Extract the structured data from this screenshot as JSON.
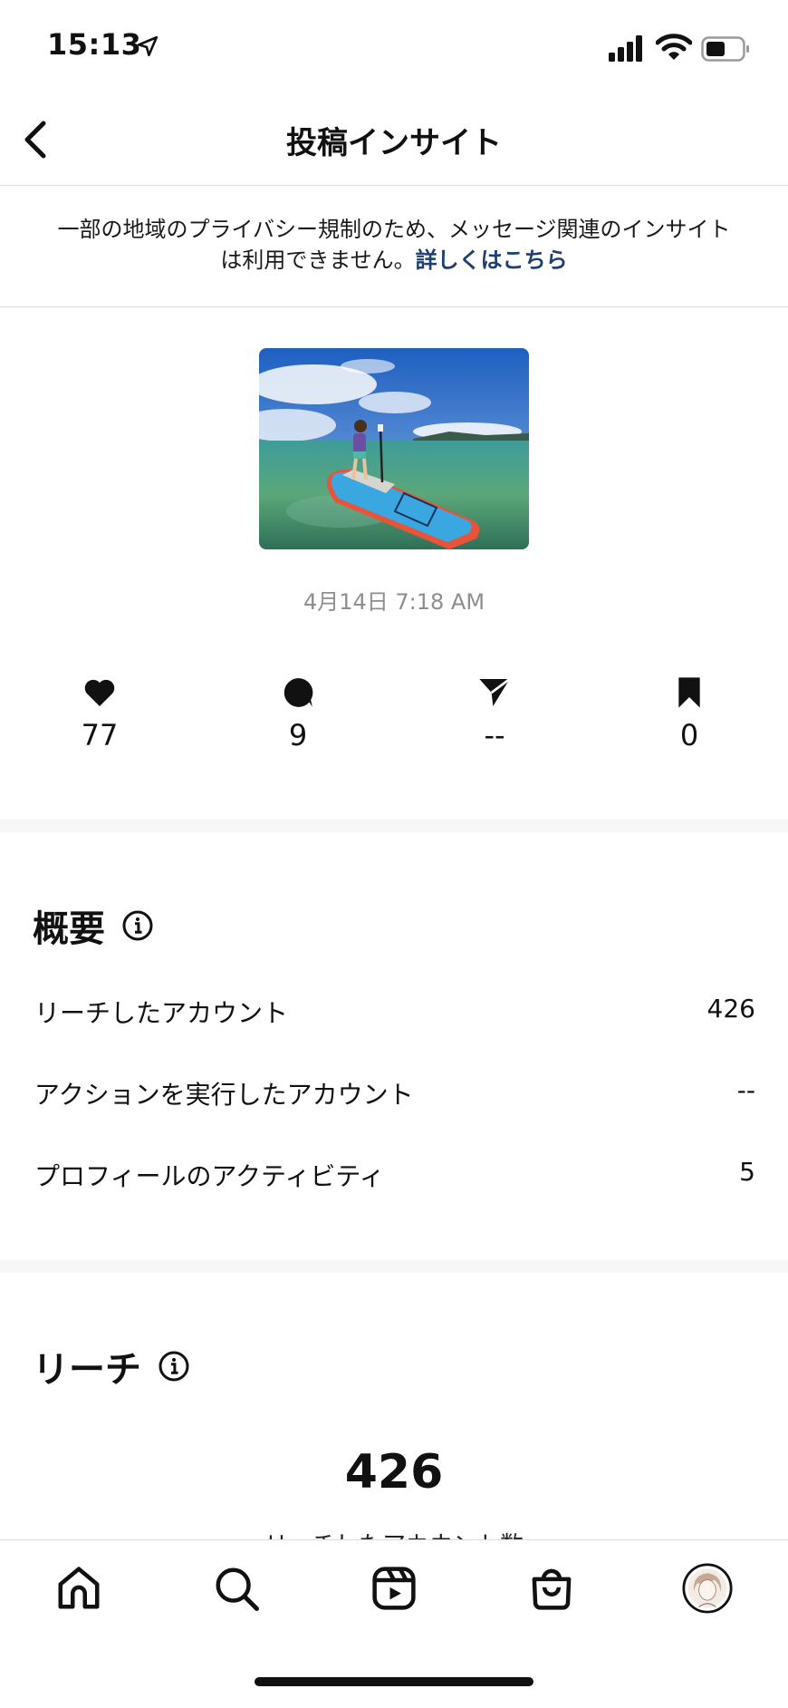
{
  "status_bar": {
    "time": "15:13"
  },
  "header": {
    "title": "投稿インサイト"
  },
  "notice": {
    "text": "一部の地域のプライバシー規制のため、メッセージ関連のインサイトは利用できません。",
    "link": "詳しくはこちら"
  },
  "post": {
    "date": "4月14日 7:18 AM"
  },
  "metrics": {
    "likes": "77",
    "comments": "9",
    "shares": "--",
    "saves": "0"
  },
  "overview": {
    "title": "概要",
    "rows": [
      {
        "label": "リーチしたアカウント",
        "value": "426"
      },
      {
        "label": "アクションを実行したアカウント",
        "value": "--"
      },
      {
        "label": "プロフィールのアクティビティ",
        "value": "5"
      }
    ]
  },
  "reach": {
    "title": "リーチ",
    "value": "426",
    "subtitle": "リーチしたアカウント数"
  },
  "tabbar": {
    "items": [
      "home-icon",
      "search-icon",
      "reels-icon",
      "shop-icon",
      "profile-avatar"
    ]
  }
}
